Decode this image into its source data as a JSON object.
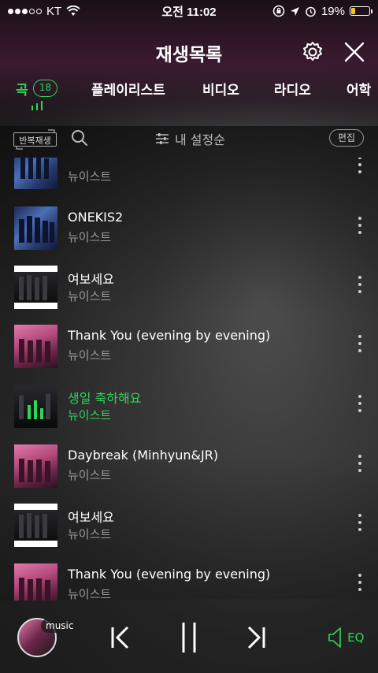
{
  "status": {
    "carrier": "KT",
    "time": "오전 11:02",
    "battery": "19%"
  },
  "header": {
    "title": "재생목록"
  },
  "tabs": [
    {
      "label": "곡",
      "active": true,
      "count": "18"
    },
    {
      "label": "플레이리스트"
    },
    {
      "label": "비디오"
    },
    {
      "label": "라디오"
    },
    {
      "label": "어학"
    }
  ],
  "toolbar": {
    "repeat_label": "반복재생",
    "sort_label": "내 설정순",
    "edit_label": "편집"
  },
  "songs": [
    {
      "title": "' ' ' '",
      "artist": "뉴이스트",
      "cover": "blue"
    },
    {
      "title": "ONEKIS2",
      "artist": "뉴이스트",
      "cover": "blue"
    },
    {
      "title": "여보세요",
      "artist": "뉴이스트",
      "cover": "dark"
    },
    {
      "title": "Thank You (evening by evening)",
      "artist": "뉴이스트",
      "cover": "pink"
    },
    {
      "title": "생일 축하해요",
      "artist": "뉴이스트",
      "cover": "dark",
      "playing": true
    },
    {
      "title": "Daybreak (Minhyun&JR)",
      "artist": "뉴이스트",
      "cover": "pink"
    },
    {
      "title": "여보세요",
      "artist": "뉴이스트",
      "cover": "dark"
    },
    {
      "title": "Thank You (evening by evening)",
      "artist": "뉴이스트",
      "cover": "pink"
    }
  ],
  "player": {
    "source_tag": "music",
    "eq_label": "EQ"
  },
  "colors": {
    "accent": "#2fd55a",
    "battery": "#f5c518"
  }
}
